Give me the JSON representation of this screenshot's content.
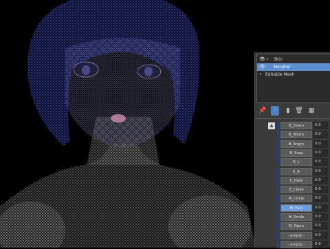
{
  "modifier_stack": [
    {
      "label": "Skin",
      "visible": true,
      "expandable": true,
      "selected": false
    },
    {
      "label": "Morpher",
      "visible": true,
      "expandable": false,
      "selected": true
    },
    {
      "label": "Editable Mesh",
      "visible": false,
      "expandable": true,
      "selected": false
    }
  ],
  "toolbar": {
    "icons": [
      "pin-stack-icon",
      "show-end-result-icon",
      "make-unique-icon",
      "remove-modifier-icon",
      "configure-modifier-sets-icon"
    ]
  },
  "channels": [
    {
      "name": "B_Down",
      "value": "0.0",
      "active": false
    },
    {
      "name": "B_Worry",
      "value": "0.0",
      "active": false
    },
    {
      "name": "B_Angry",
      "value": "0.0",
      "active": false
    },
    {
      "name": "B_Surp",
      "value": "0.0",
      "active": false
    },
    {
      "name": "E_L",
      "value": "0.0",
      "active": false
    },
    {
      "name": "E_R",
      "value": "0.0",
      "active": false
    },
    {
      "name": "E_Hate",
      "value": "0.0",
      "active": false
    },
    {
      "name": "E_Close",
      "value": "0.0",
      "active": false
    },
    {
      "name": "M_Circle",
      "value": "0.0",
      "active": false
    },
    {
      "name": "M_Pain",
      "value": "0.0",
      "active": true
    },
    {
      "name": "M_Smile",
      "value": "0.0",
      "active": false
    },
    {
      "name": "M_Open",
      "value": "0.0",
      "active": false
    },
    {
      "name": "- empty -",
      "value": "0.0",
      "active": false
    },
    {
      "name": "- empty -",
      "value": "0.0",
      "active": false
    }
  ],
  "colors": {
    "panel_bg": "#3a3a3a",
    "selected": "#5d8fcf",
    "wire_white": "#d9d9d9",
    "wire_blue": "#3b47c8"
  }
}
